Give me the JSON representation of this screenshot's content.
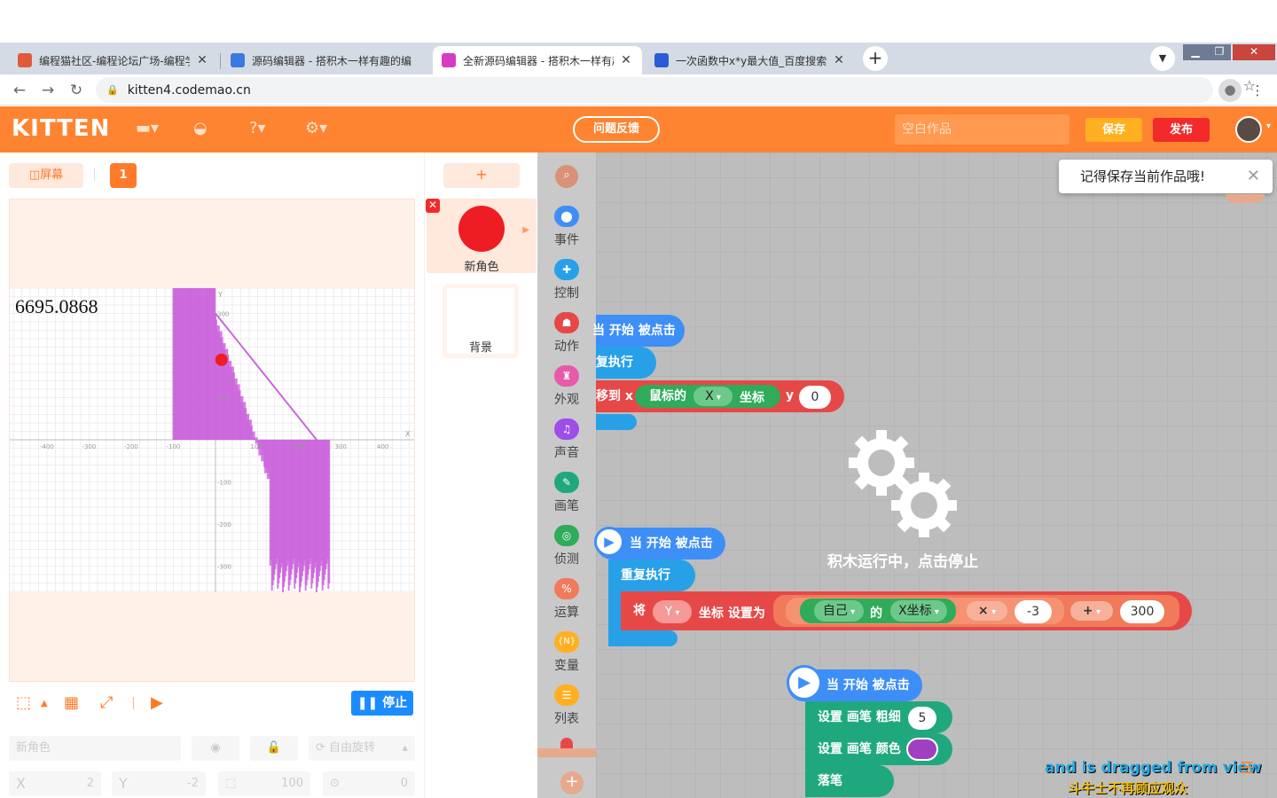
{
  "browser": {
    "tabs": [
      {
        "title": "编程猫社区-编程论坛广场-编程学",
        "fav_color": "#e05a3a",
        "active": false
      },
      {
        "title": "源码编辑器 - 搭积木一样有趣的编",
        "fav_color": "#3a7ae0",
        "active": false
      },
      {
        "title": "全新源码编辑器 - 搭积木一样有趣",
        "fav_color": "#d43cc4",
        "active": true
      },
      {
        "title": "一次函数中x*y最大值_百度搜索",
        "fav_color": "#2b5bd6",
        "active": false
      }
    ],
    "url": "kitten4.codemao.cn"
  },
  "header": {
    "logo": "KITTEN",
    "feedback_label": "问题反馈",
    "project_placeholder": "空白作品",
    "save_label": "保存",
    "publish_label": "发布"
  },
  "stage": {
    "screen_label": "屏幕",
    "page_number": "1",
    "readout": "6695.0868",
    "axis_labels": {
      "x": "X",
      "y": "Y"
    },
    "x_ticks": [
      "-400",
      "-300",
      "-200",
      "-100",
      "0",
      "100",
      "200",
      "300",
      "400"
    ],
    "y_ticks": [
      "300",
      "200",
      "100",
      "-100",
      "-200",
      "-300"
    ],
    "stop_label": "停止"
  },
  "sprite_props": {
    "name_placeholder": "新角色",
    "rotate_label": "自由旋转",
    "x_label": "X",
    "x_value": "2",
    "y_label": "Y",
    "y_value": "-2",
    "size_value": "100",
    "direction_value": "0"
  },
  "sprites": {
    "add_label": "+",
    "sprite_name": "新角色",
    "sprite_color": "#ee1d23",
    "background_name": "背景"
  },
  "categories": [
    {
      "label": "事件",
      "color": "#3e8ef7"
    },
    {
      "label": "控制",
      "color": "#28a0e8"
    },
    {
      "label": "动作",
      "color": "#e64848"
    },
    {
      "label": "外观",
      "color": "#e65aa8"
    },
    {
      "label": "声音",
      "color": "#9d4ee8"
    },
    {
      "label": "画笔",
      "color": "#1fa87e"
    },
    {
      "label": "侦测",
      "color": "#2fab5a"
    },
    {
      "label": "运算",
      "color": "#f07a5a"
    },
    {
      "label": "变量",
      "color": "#ffb020"
    },
    {
      "label": "列表",
      "color": "#ffb020"
    }
  ],
  "blocks": {
    "script1": {
      "hat": "当 开始 被点击",
      "loop": "复执行",
      "move_to_x": "移到 x",
      "mouse_label": "鼠标的",
      "mouse_axis": "X",
      "coord_label": "坐标",
      "y_label": "y",
      "y_value": "0"
    },
    "script2": {
      "hat": "当 开始 被点击",
      "loop": "重复执行",
      "set_label": "将",
      "set_target": "Y",
      "set_text": "坐标 设置为",
      "self_label": "自己",
      "of_label": "的",
      "x_coord_label": "X坐标",
      "times_op": "×",
      "factor": "-3",
      "plus_op": "+",
      "offset": "300"
    },
    "script3": {
      "hat": "当 开始 被点击",
      "pen_size_label": "设置 画笔 粗细",
      "pen_size_value": "5",
      "pen_color_label": "设置 画笔 颜色",
      "pen_color": "#a040c0",
      "pen_down_label": "落笔"
    }
  },
  "overlay": {
    "running_message": "积木运行中，点击停止",
    "toast": "记得保存当前作品哦!",
    "subtitle_en": "and is dragged from view",
    "subtitle_zh": "斗牛士不再顾应观众"
  },
  "colors": {
    "brand": "#ff8431",
    "pen": "#cc66dd",
    "event_block": "#3e8ef7",
    "control_block": "#28a0e8",
    "motion_block": "#e64848",
    "sensing_block": "#2fab5a",
    "pen_block": "#1fa87e"
  }
}
